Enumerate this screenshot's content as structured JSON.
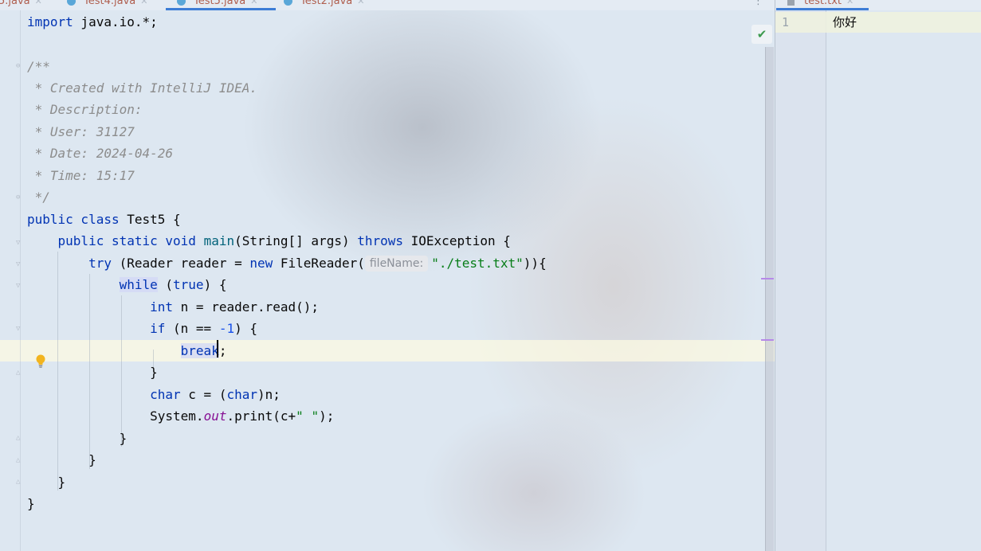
{
  "tabs": [
    {
      "label": "5.java"
    },
    {
      "label": "Test4.java"
    },
    {
      "label": "Test5.java",
      "active": true
    },
    {
      "label": "Test2.java"
    }
  ],
  "right_tab": {
    "label": "test.txt"
  },
  "code": {
    "l1_kw": "import",
    "l1_rest": " java.io.*;",
    "l3": "/**",
    "l4": " * Created with IntelliJ IDEA.",
    "l5": " * Description:",
    "l6": " * User: 31127",
    "l7": " * Date: 2024-04-26",
    "l8": " * Time: 15:17",
    "l9": " */",
    "l10_kw": "public class",
    "l10_rest": " Test5 {",
    "l11_kw1": "public static void",
    "l11_fn": "main",
    "l11_mid": "(String[] args) ",
    "l11_kw2": "throws",
    "l11_rest": " IOException {",
    "l12_kw": "try",
    "l12_mid": " (Reader reader = ",
    "l12_new": "new",
    "l12_mid2": " FileReader(",
    "l12_hint": "fileName:",
    "l12_str": "\"./test.txt\"",
    "l12_end": ")){",
    "l13_kw": "while",
    "l13_mid": " (",
    "l13_true": "true",
    "l13_end": ") {",
    "l14_kw": "int",
    "l14_rest": " n = reader.read();",
    "l15_kw": "if",
    "l15_mid": " (n == ",
    "l15_num": "-1",
    "l15_end": ") {",
    "l16_kw": "break",
    "l16_end": ";",
    "l17": "}",
    "l18_kw": "char",
    "l18_mid": " c = (",
    "l18_kw2": "char",
    "l18_end": ")n;",
    "l19_a": "System.",
    "l19_fld": "out",
    "l19_b": ".print(c+",
    "l19_str": "\" \"",
    "l19_end": ");",
    "l20": "}",
    "l21": "}",
    "l22": "}",
    "l23": "}"
  },
  "right_editor": {
    "line_number": "1",
    "text": "你好"
  },
  "icons": {
    "bulb": "lightbulb-icon",
    "check": "check-icon"
  },
  "colors": {
    "keyword": "#0033b3",
    "string": "#067d17",
    "comment": "#8c8c8c",
    "number": "#1750eb",
    "accent": "#3d7dd6"
  }
}
